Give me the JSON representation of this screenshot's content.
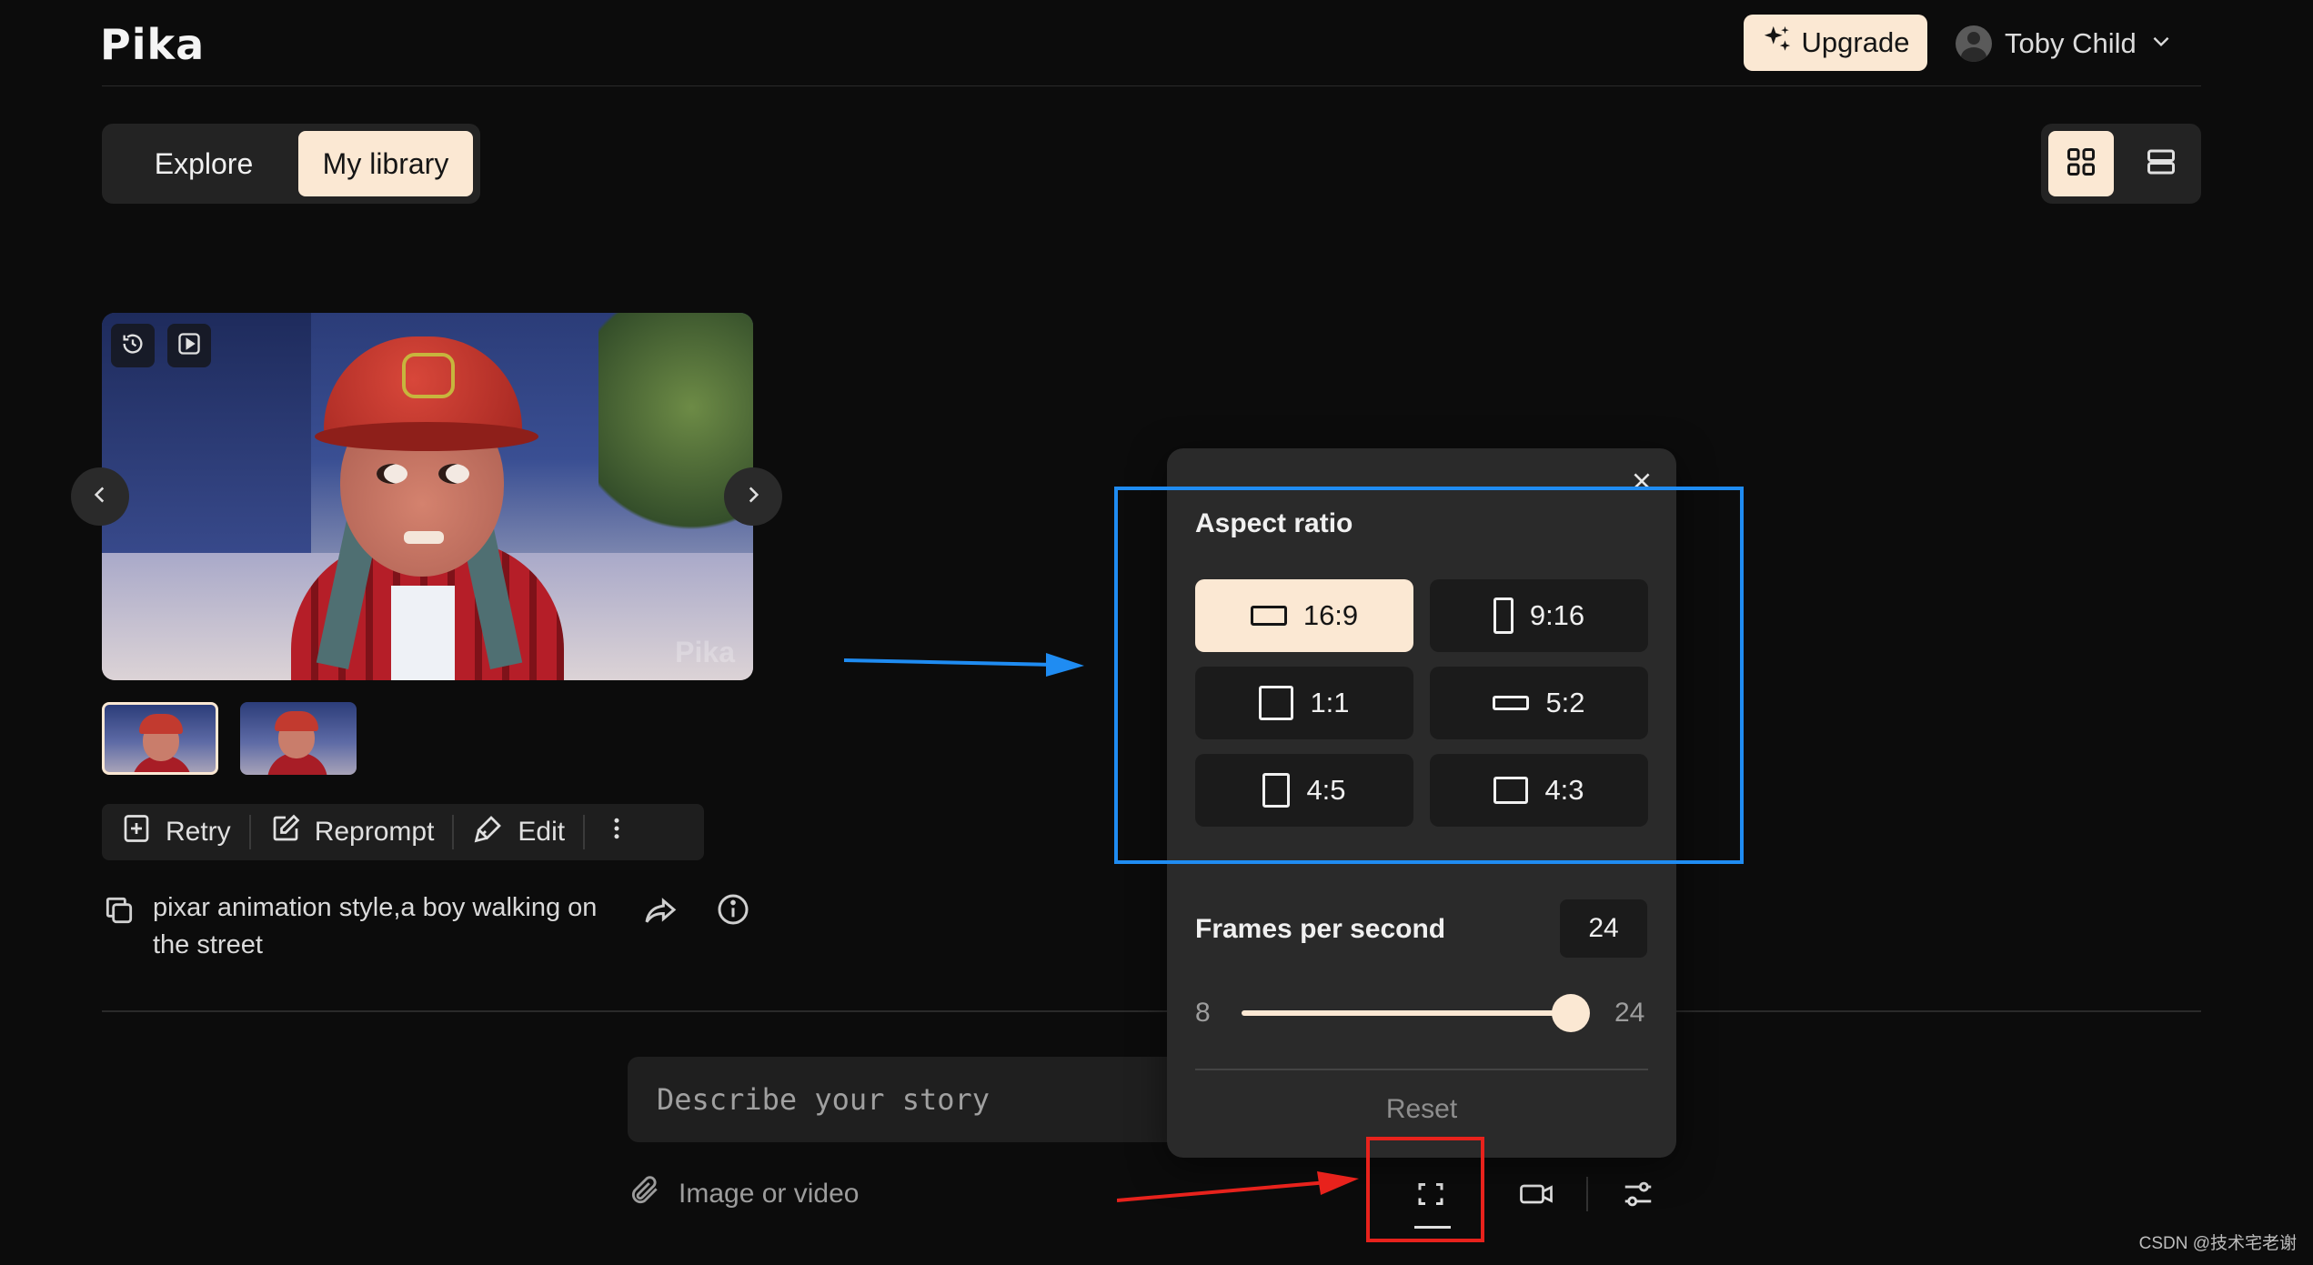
{
  "app": {
    "logo": "Pika"
  },
  "header": {
    "upgrade_label": "Upgrade",
    "user_name": "Toby Child"
  },
  "tabs": {
    "explore": "Explore",
    "my_library": "My library",
    "active": "My library"
  },
  "view": {
    "active": "grid"
  },
  "video": {
    "watermark": "Pika"
  },
  "actions": {
    "retry": "Retry",
    "reprompt": "Reprompt",
    "edit": "Edit"
  },
  "prompt": {
    "text": "pixar animation style,a boy walking on the street"
  },
  "composer": {
    "placeholder": "Describe your story",
    "attach_label": "Image or video"
  },
  "popover": {
    "aspect_title": "Aspect ratio",
    "ratios": [
      {
        "label": "16:9",
        "active": true
      },
      {
        "label": "9:16",
        "active": false
      },
      {
        "label": "1:1",
        "active": false
      },
      {
        "label": "5:2",
        "active": false
      },
      {
        "label": "4:5",
        "active": false
      },
      {
        "label": "4:3",
        "active": false
      }
    ],
    "fps_title": "Frames per second",
    "fps_value": "24",
    "fps_min": "8",
    "fps_max": "24",
    "fps_fraction": 1.0,
    "reset_label": "Reset"
  },
  "colors": {
    "accent": "#fbe8d3",
    "background": "#0c0c0c",
    "annotation_blue": "#1f8cf2",
    "annotation_red": "#e8221c"
  },
  "watermark_credit": "CSDN @技术宅老谢"
}
